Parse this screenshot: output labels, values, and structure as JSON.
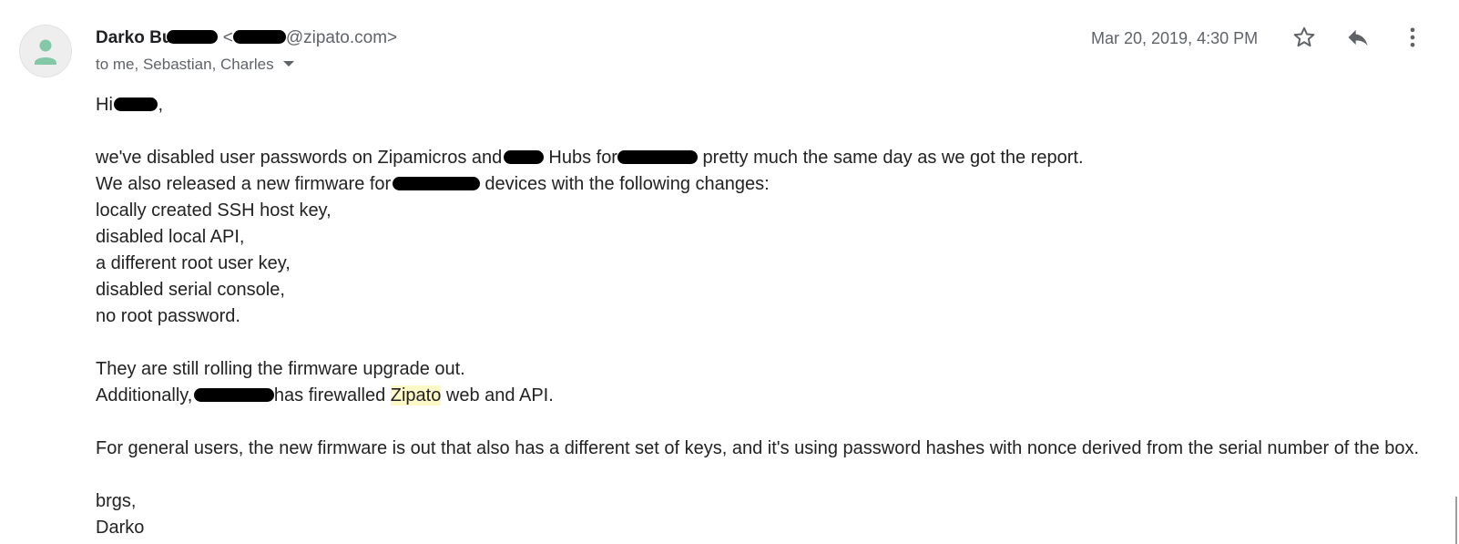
{
  "header": {
    "sender_name": "Darko Bu",
    "sender_email_suffix": "@zipato.com>",
    "sender_email_prefix": "<",
    "recipients": "to me, Sebastian, Charles",
    "date": "Mar 20, 2019, 4:30 PM"
  },
  "icons": {
    "avatar": "person-icon",
    "star": "star-icon",
    "reply": "reply-icon",
    "more": "more-vert-icon"
  },
  "colors": {
    "avatar_figure": "#83c9a7",
    "highlight": "#fdf8c8"
  },
  "body": {
    "greeting_prefix": "Hi ",
    "greeting_suffix": ",",
    "line1_a": "we've disabled user passwords on Zipamicros and ",
    "line1_b": " Hubs for",
    "line1_c": " pretty much the same day as we got the report.",
    "line2_a": "We also released a new firmware for ",
    "line2_b": " devices with the following changes:",
    "list": [
      "locally created SSH host key,",
      "disabled local API,",
      "a different root user key,",
      "disabled serial console,",
      "no root password."
    ],
    "rolling": "They are still rolling the firmware upgrade out.",
    "add_a": "Additionally, ",
    "add_b": "has firewalled ",
    "add_highlight": "Zipato",
    "add_c": " web and API.",
    "general": "For general users, the new firmware is out that also has a different set of keys, and it's using password hashes with nonce derived from the serial number of the box.",
    "sign1": "brgs,",
    "sign2": "Darko"
  }
}
